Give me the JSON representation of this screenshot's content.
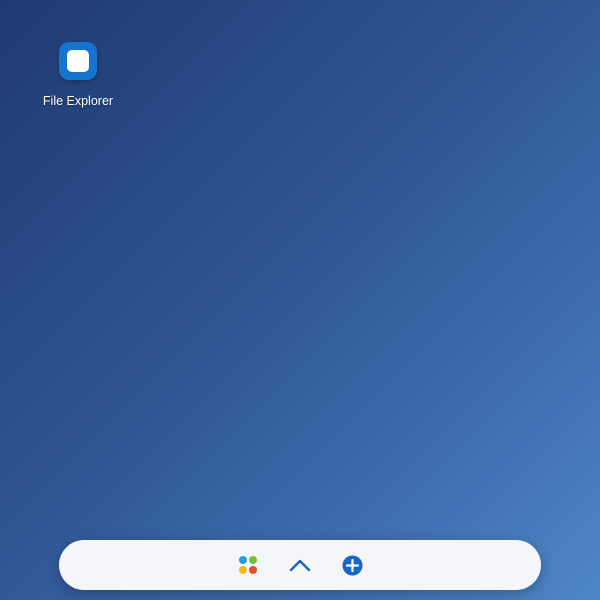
{
  "desktop": {
    "icons": [
      {
        "label": "File Explorer",
        "icon": "file-explorer-icon"
      }
    ]
  },
  "taskbar": {
    "launcher": {
      "icon": "app-launcher-icon",
      "colors": [
        "#2d9be0",
        "#6fc13a",
        "#f2b818",
        "#e0502b"
      ]
    },
    "expand": {
      "icon": "chevron-up-icon",
      "color": "#1667c2"
    },
    "add": {
      "icon": "plus-circle-icon",
      "color": "#1667c2"
    }
  }
}
